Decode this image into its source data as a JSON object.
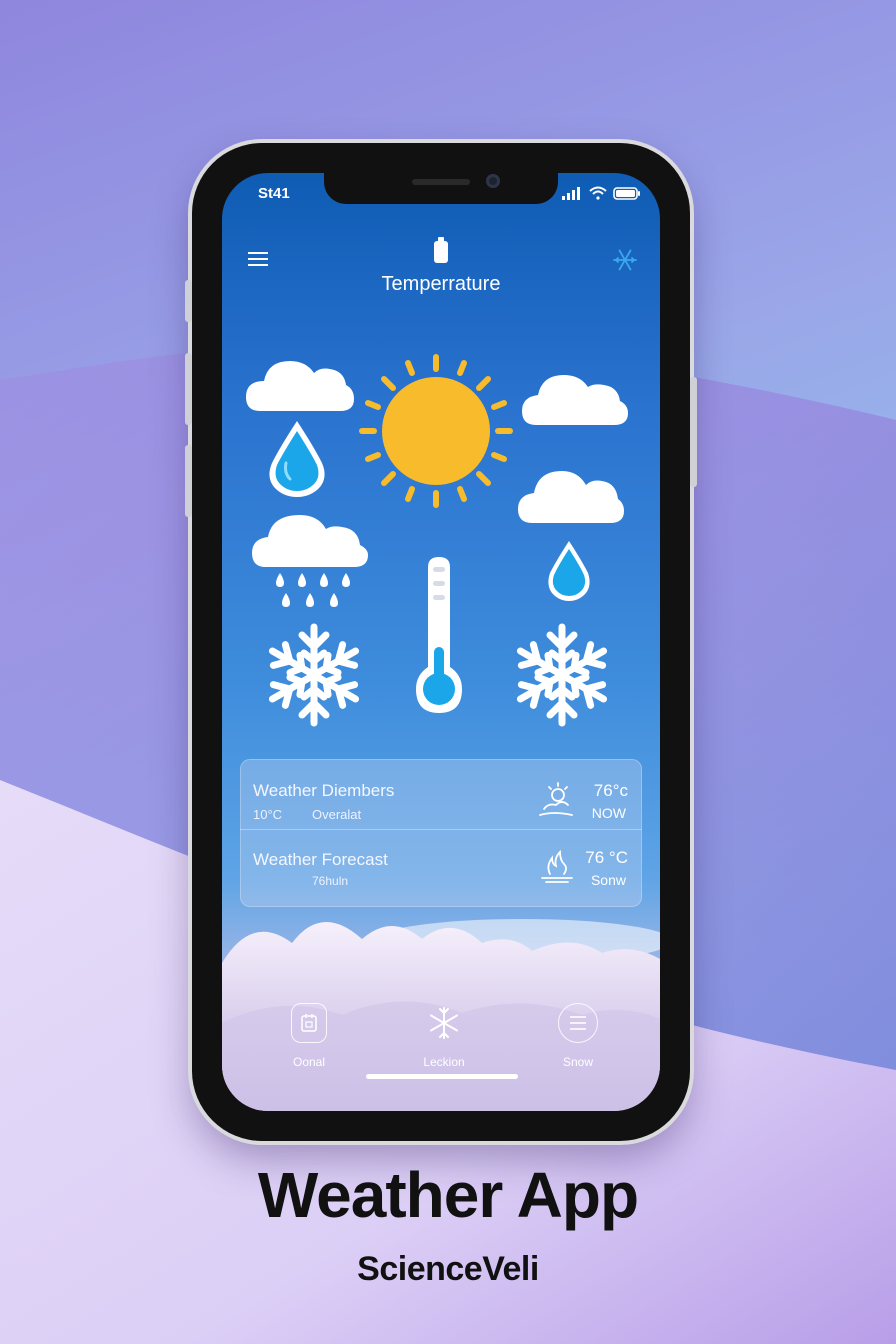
{
  "colors": {
    "screen_top": "#0f5cb4",
    "sun": "#f7bb2c",
    "water": "#1aa6e8",
    "accent_purple": "#7b4fcf"
  },
  "status_bar": {
    "time": "St41",
    "icons": [
      "signal-icon",
      "wifi-icon",
      "battery-icon"
    ]
  },
  "header": {
    "title": "Temperrature",
    "left_icon": "hamburger-menu-icon",
    "center_icon": "lock-icon",
    "right_icon": "snowflake-settings-icon"
  },
  "weather_icons": [
    "cloud-icon",
    "sun-icon",
    "cloud-icon",
    "raindrop-icon",
    "cloud-icon",
    "rain-cloud-icon",
    "thermometer-icon",
    "raindrop-icon",
    "snowflake-icon",
    "snowflake-icon"
  ],
  "rows": [
    {
      "title": "Weather Diembers",
      "sub_left": "10°C",
      "sub_right": "Overalat",
      "temp": "76°c",
      "label": "NOW",
      "icon": "partly-sunny-icon"
    },
    {
      "title": "Weather Forecast",
      "sub_left": "76huln",
      "temp": "76 °C",
      "label": "Sonw",
      "icon": "fire-icon"
    }
  ],
  "nav": [
    {
      "label": "Oonal",
      "icon": "calendar-icon"
    },
    {
      "label": "Leckion",
      "icon": "snowflake-icon"
    },
    {
      "label": "Snow",
      "icon": "list-icon"
    }
  ],
  "footer": {
    "app_title": "Weather App",
    "brand": "ScienceVeli"
  }
}
